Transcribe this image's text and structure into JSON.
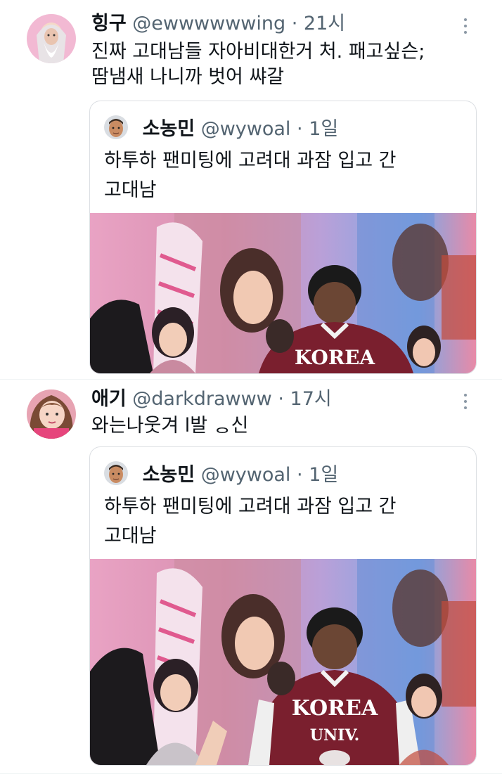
{
  "tweets": [
    {
      "name": "힝구",
      "handle": "@ewwwwwwing",
      "time": "21시",
      "text_lines": [
        "진짜 고대남들 자아비대한거 처. 패고싶슨;",
        "땀냄새 나니까 벗어 쌰갈"
      ],
      "quote": {
        "name": "소농민",
        "handle": "@wywoal",
        "time": "1일",
        "text_lines": [
          "하투하 팬미팅에 고려대 과잠 입고 간",
          "고대남"
        ],
        "jacket_text": "KOREA"
      }
    },
    {
      "name": "애기",
      "handle": "@darkdrawww",
      "time": "17시",
      "text_lines": [
        "와는나웃겨 l발 ᆼ신"
      ],
      "quote": {
        "name": "소농민",
        "handle": "@wywoal",
        "time": "1일",
        "text_lines": [
          "하투하 팬미팅에 고려대 과잠 입고 간",
          "고대남"
        ],
        "jacket_text": "KOREA",
        "jacket_text_2": "UNIV."
      }
    }
  ],
  "separator": "·",
  "icons": {
    "more": "more-vertical-icon"
  },
  "colors": {
    "text": "#0f1419",
    "meta": "#536471",
    "jacket": "#7a1f2e"
  }
}
